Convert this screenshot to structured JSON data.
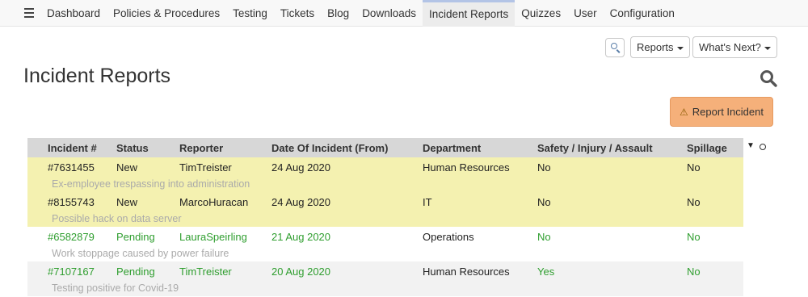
{
  "nav": {
    "items": [
      {
        "label": "Dashboard"
      },
      {
        "label": "Policies & Procedures"
      },
      {
        "label": "Testing"
      },
      {
        "label": "Tickets"
      },
      {
        "label": "Blog"
      },
      {
        "label": "Downloads"
      },
      {
        "label": "Incident Reports",
        "active": true
      },
      {
        "label": "Quizzes"
      },
      {
        "label": "User"
      },
      {
        "label": "Configuration"
      }
    ]
  },
  "toolbar": {
    "reports_label": "Reports",
    "whats_next_label": "What's Next?"
  },
  "page": {
    "title": "Incident Reports",
    "report_button": "Report Incident"
  },
  "table": {
    "headers": [
      "Incident #",
      "Status",
      "Reporter",
      "Date Of Incident (From)",
      "Department",
      "Safety / Injury / Assault",
      "Spillage"
    ],
    "rows": [
      {
        "id": "#7631455",
        "status": "New",
        "reporter": "TimTreister",
        "date": "24 Aug 2020",
        "department": "Human Resources",
        "safety": "No",
        "spillage": "No",
        "description": "Ex-employee trespassing into administration"
      },
      {
        "id": "#8155743",
        "status": "New",
        "reporter": "MarcoHuracan",
        "date": "24 Aug 2020",
        "department": "IT",
        "safety": "No",
        "spillage": "No",
        "description": "Possible hack on data server"
      },
      {
        "id": "#6582879",
        "status": "Pending",
        "reporter": "LauraSpeirling",
        "date": "21 Aug 2020",
        "department": "Operations",
        "safety": "No",
        "spillage": "No",
        "description": "Work stoppage caused by power failure"
      },
      {
        "id": "#7107167",
        "status": "Pending",
        "reporter": "TimTreister",
        "date": "20 Aug 2020",
        "department": "Human Resources",
        "safety": "Yes",
        "spillage": "No",
        "description": "Testing positive for Covid-19"
      }
    ]
  },
  "colors": {
    "new_row_bg": "#f4f1b0",
    "pending_text": "#2f9e2f",
    "report_button_bg": "#f5b07a",
    "header_bg": "#d7d7d7"
  }
}
